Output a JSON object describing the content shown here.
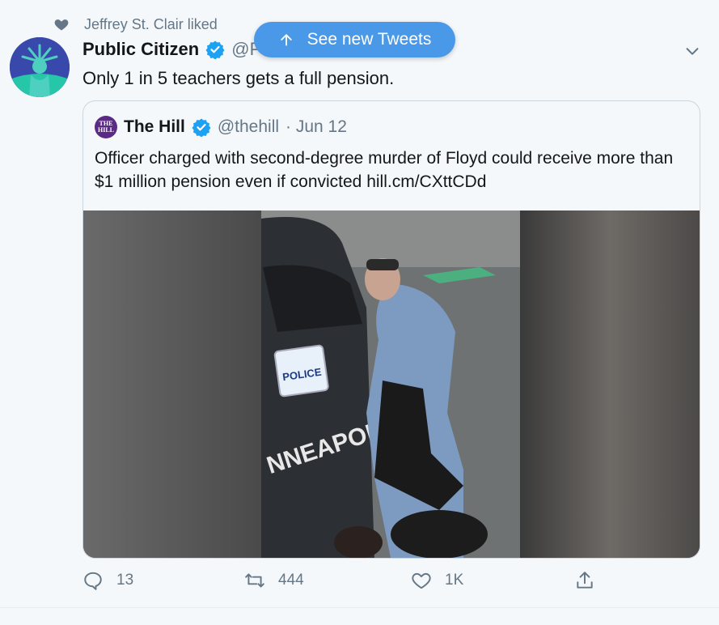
{
  "context": {
    "liked_by": "Jeffrey St. Clair liked"
  },
  "author": {
    "name": "Public Citizen",
    "handle": "@Pu"
  },
  "tweet": {
    "text": "Only 1 in 5 teachers gets a full pension."
  },
  "new_tweets": {
    "label": "See new Tweets"
  },
  "quoted": {
    "name": "The Hill",
    "handle": "@thehill",
    "date": "· Jun 12",
    "text": "Officer charged with second-degree murder of Floyd could receive more than $1 million pension even if convicted hill.cm/CXttCDd",
    "image": {
      "plate": "POLICE",
      "vehicle_lettering": "NNEAPOLIS"
    }
  },
  "actions": {
    "replies": "13",
    "retweets": "444",
    "likes": "1K"
  },
  "icons": {
    "heart": "heart-icon",
    "verified": "verified-badge-icon",
    "chevron": "chevron-down-icon",
    "arrow": "arrow-up-icon",
    "reply": "reply-icon",
    "retweet": "retweet-icon",
    "like": "like-icon",
    "share": "share-icon"
  },
  "colors": {
    "accent": "#1da1f2",
    "muted": "#657786",
    "button": "#4a99e9"
  }
}
